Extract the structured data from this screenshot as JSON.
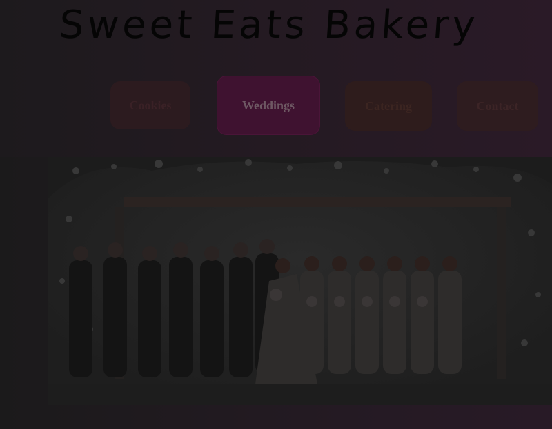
{
  "site": {
    "title": "Sweet Eats Bakery"
  },
  "nav": {
    "items": [
      {
        "label": "Cookies"
      },
      {
        "label": "Weddings"
      },
      {
        "label": "Catering"
      },
      {
        "label": "Contact"
      }
    ],
    "active": "Weddings"
  },
  "colors": {
    "overlay": "#1b1a1b",
    "active_tab": "#3f1230",
    "title_text": "#050505"
  },
  "hero": {
    "image": "wedding party photo"
  }
}
